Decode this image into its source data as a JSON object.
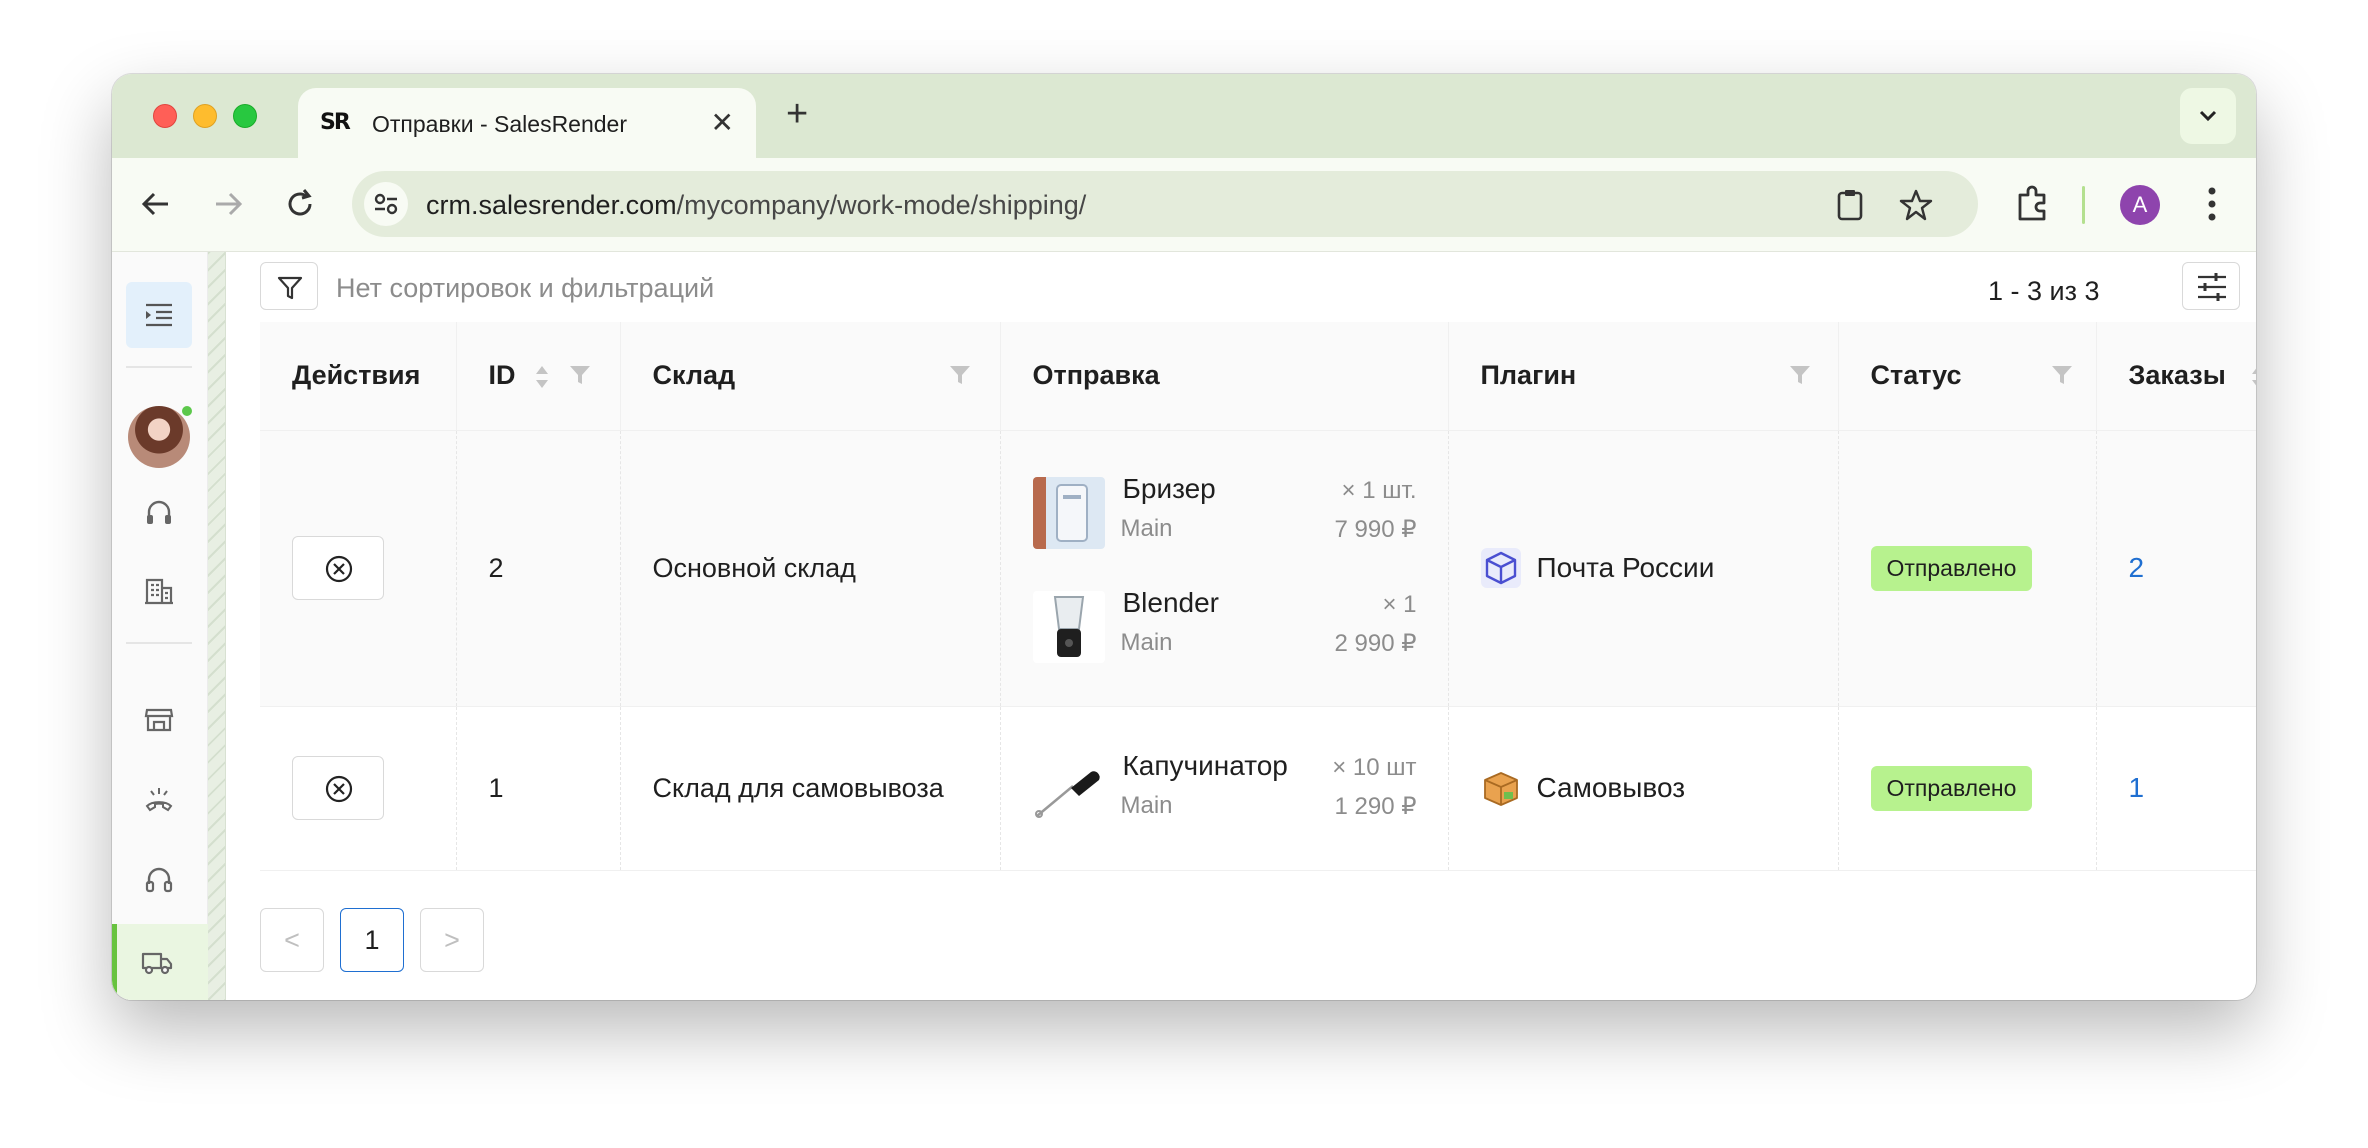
{
  "browser": {
    "tab_title": "Отправки - SalesRender",
    "favicon_text": "SR",
    "url_host": "crm.salesrender.com",
    "url_path": "/mycompany/work-mode/shipping/",
    "profile_letter": "A"
  },
  "toolbar": {
    "filter_placeholder": "Нет сортировок и фильтраций",
    "paging_info": "1 - 3 из 3"
  },
  "table": {
    "columns": [
      "Действия",
      "ID",
      "Склад",
      "Отправка",
      "Плагин",
      "Статус",
      "Заказы"
    ],
    "rows": [
      {
        "id": "2",
        "warehouse": "Основной склад",
        "items": [
          {
            "name": "Бризер",
            "qty": "× 1 шт.",
            "variant": "Main",
            "price": "7 990 ₽"
          },
          {
            "name": "Blender",
            "qty": "× 1",
            "variant": "Main",
            "price": "2 990 ₽"
          }
        ],
        "plugin": "Почта России",
        "status": "Отправлено",
        "orders": "2"
      },
      {
        "id": "1",
        "warehouse": "Склад для самовывоза",
        "items": [
          {
            "name": "Капучинатор",
            "qty": "× 10 шт",
            "variant": "Main",
            "price": "1 290 ₽"
          }
        ],
        "plugin": "Самовывоз",
        "status": "Отправлено",
        "orders": "1"
      }
    ]
  },
  "pagination": {
    "prev": "<",
    "current": "1",
    "next": ">"
  },
  "colors": {
    "accent": "#68c33f",
    "status_badge": "#b7f28e",
    "link": "#1f6fd1",
    "tabstrip": "#dce8d2"
  }
}
